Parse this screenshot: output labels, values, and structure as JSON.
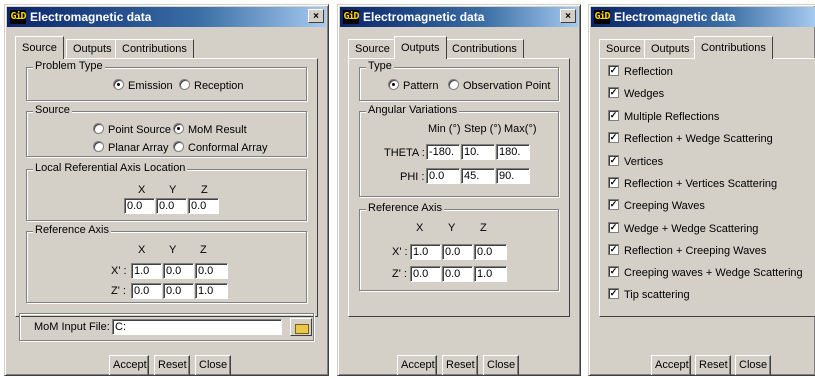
{
  "windows": [
    {
      "title": "Electromagnetic data",
      "app_icon": "GiD",
      "close_glyph": "×",
      "tabs": [
        {
          "label": "Source"
        },
        {
          "label": "Outputs"
        },
        {
          "label": "Contributions"
        }
      ],
      "active_tab": "Source",
      "problem_type": {
        "title": "Problem Type",
        "options": [
          {
            "label": "Emission",
            "selected": true
          },
          {
            "label": "Reception",
            "selected": false
          }
        ]
      },
      "source": {
        "title": "Source",
        "options": [
          {
            "label": "Point Source",
            "selected": false
          },
          {
            "label": "MoM Result",
            "selected": true
          },
          {
            "label": "Planar Array",
            "selected": false
          },
          {
            "label": "Conformal Array",
            "selected": false
          }
        ]
      },
      "local_axis": {
        "title": "Local Referential Axis Location",
        "headers": [
          "X",
          "Y",
          "Z"
        ],
        "values": [
          "0.0",
          "0.0",
          "0.0"
        ]
      },
      "reference_axis": {
        "title": "Reference Axis",
        "headers": [
          "X",
          "Y",
          "Z"
        ],
        "rows": [
          {
            "label": "X' :",
            "values": [
              "1.0",
              "0.0",
              "0.0"
            ]
          },
          {
            "label": "Z' :",
            "values": [
              "0.0",
              "0.0",
              "1.0"
            ]
          }
        ]
      },
      "mom_input": {
        "label": "MoM Input File:",
        "value": "C:"
      },
      "buttons": {
        "accept": "Accept",
        "reset": "Reset",
        "close": "Close"
      }
    },
    {
      "title": "Electromagnetic data",
      "app_icon": "GiD",
      "close_glyph": "×",
      "tabs": [
        {
          "label": "Source"
        },
        {
          "label": "Outputs"
        },
        {
          "label": "Contributions"
        }
      ],
      "active_tab": "Outputs",
      "type": {
        "title": "Type",
        "options": [
          {
            "label": "Pattern",
            "selected": true
          },
          {
            "label": "Observation Point",
            "selected": false
          }
        ]
      },
      "angular": {
        "title": "Angular Variations",
        "headers": [
          "Min (°)",
          "Step (°)",
          "Max(°)"
        ],
        "rows": [
          {
            "label": "THETA :",
            "values": [
              "-180.",
              "10.",
              "180."
            ]
          },
          {
            "label": "PHI :",
            "values": [
              "0.0",
              "45.",
              "90."
            ]
          }
        ]
      },
      "reference_axis": {
        "title": "Reference Axis",
        "headers": [
          "X",
          "Y",
          "Z"
        ],
        "rows": [
          {
            "label": "X' :",
            "values": [
              "1.0",
              "0.0",
              "0.0"
            ]
          },
          {
            "label": "Z' :",
            "values": [
              "0.0",
              "0.0",
              "1.0"
            ]
          }
        ]
      },
      "buttons": {
        "accept": "Accept",
        "reset": "Reset",
        "close": "Close"
      }
    },
    {
      "title": "Electromagnetic data",
      "app_icon": "GiD",
      "tabs": [
        {
          "label": "Source"
        },
        {
          "label": "Outputs"
        },
        {
          "label": "Contributions"
        }
      ],
      "active_tab": "Contributions",
      "contributions": [
        {
          "label": "Reflection",
          "checked": true
        },
        {
          "label": "Wedges",
          "checked": true
        },
        {
          "label": "Multiple Reflections",
          "checked": true
        },
        {
          "label": "Reflection + Wedge Scattering",
          "checked": true
        },
        {
          "label": "Vertices",
          "checked": true
        },
        {
          "label": "Reflection + Vertices Scattering",
          "checked": true
        },
        {
          "label": "Creeping Waves",
          "checked": true
        },
        {
          "label": "Wedge + Wedge Scattering",
          "checked": true
        },
        {
          "label": "Reflection + Creeping Waves",
          "checked": true
        },
        {
          "label": "Creeping waves + Wedge Scattering",
          "checked": true
        },
        {
          "label": "Tip scattering",
          "checked": true
        }
      ],
      "buttons": {
        "accept": "Accept",
        "reset": "Reset",
        "close": "Close"
      }
    }
  ],
  "colors": {
    "face": "#d4d0c8",
    "titlebar": "#0a246a"
  }
}
